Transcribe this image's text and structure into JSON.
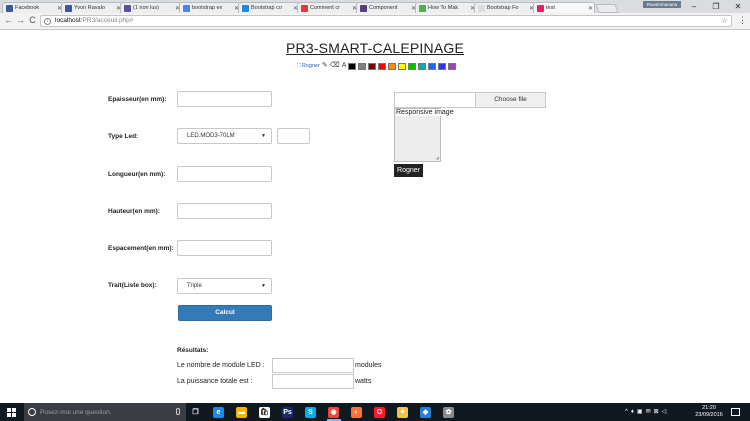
{
  "browser": {
    "tabs": [
      {
        "title": "Facebook",
        "favicon_color": "#3b5998",
        "active": false
      },
      {
        "title": "Yvon Ravalo",
        "favicon_color": "#3b5998",
        "active": false
      },
      {
        "title": "(1 non lus)",
        "favicon_color": "#5b4fa0",
        "active": false
      },
      {
        "title": "bootstrap ex",
        "favicon_color": "#4285f4",
        "active": false
      },
      {
        "title": "Bootstrap co",
        "favicon_color": "#1e88e5",
        "active": false
      },
      {
        "title": "Comment cr",
        "favicon_color": "#e53935",
        "active": false
      },
      {
        "title": "Component",
        "favicon_color": "#563d7c",
        "active": false
      },
      {
        "title": "How To Mak",
        "favicon_color": "#4caf50",
        "active": false
      },
      {
        "title": "Bootstrap Fo",
        "favicon_color": "#dddddd",
        "active": false
      },
      {
        "title": "test",
        "favicon_color": "#e91e63",
        "active": true
      }
    ],
    "close_glyph": "✕",
    "user_badge": "Ravalomanana",
    "window_buttons": {
      "minimize": "–",
      "restore": "❐",
      "close": "✕"
    },
    "url_host": "localhost",
    "url_path": "/PR3/acceuil.php#",
    "nav": {
      "back": "←",
      "forward": "→",
      "reload": "C",
      "menu": "⋮",
      "star": "☆",
      "info": "i"
    }
  },
  "page": {
    "title": "PR3-SMART-CALEPINAGE",
    "toolbar": {
      "crop_label": "Rogner",
      "glyphs": [
        "✎",
        "⌫",
        "A"
      ],
      "swatches": [
        "#000000",
        "#808080",
        "#7f0000",
        "#ff0000",
        "#ff8c00",
        "#ffff00",
        "#00c000",
        "#00b0b0",
        "#1e64ff",
        "#3333ff",
        "#a040c0"
      ]
    },
    "form": {
      "epaisseur_label": "Epaisseur(en mm):",
      "type_led_label": "Type Led:",
      "type_led_value": "LED.MOD3-70LM",
      "longueur_label": "Longueur(en mm):",
      "hauteur_label": "Hauteur(en mm):",
      "espacement_label": "Espacement(en mm):",
      "trait_label": "Trait(Liste box):",
      "trait_value": "Triple",
      "caret": "▼",
      "calcul_button": "Calcul"
    },
    "image_panel": {
      "file_button": "Choose file",
      "preview_alt": "Responsive image",
      "crop_button": "Rogner"
    },
    "results": {
      "title": "Résultats:",
      "modules_label": "Le nombre de module LED :",
      "modules_unit": "modules",
      "power_label": "La puissance totale est :",
      "power_unit": "watts"
    }
  },
  "taskbar": {
    "search_placeholder": "Posez-moi une question.",
    "apps": [
      {
        "name": "task-view",
        "color": "#101820",
        "glyph": "❐"
      },
      {
        "name": "edge",
        "color": "#1e88e5",
        "glyph": "e"
      },
      {
        "name": "explorer",
        "color": "#f4b400",
        "glyph": "▬"
      },
      {
        "name": "store",
        "color": "#ffffff",
        "glyph": "🛍"
      },
      {
        "name": "photoshop",
        "color": "#1b2a6b",
        "glyph": "Ps"
      },
      {
        "name": "skype",
        "color": "#00aff0",
        "glyph": "S"
      },
      {
        "name": "chrome",
        "color": "#e8453c",
        "glyph": "◉"
      },
      {
        "name": "firefox",
        "color": "#ff7139",
        "glyph": "◐"
      },
      {
        "name": "opera",
        "color": "#ff1b2d",
        "glyph": "O"
      },
      {
        "name": "wamp",
        "color": "#f6c343",
        "glyph": "✦"
      },
      {
        "name": "3d-app",
        "color": "#2a7fd4",
        "glyph": "◆"
      },
      {
        "name": "tool-app",
        "color": "#8a8a8a",
        "glyph": "✿"
      }
    ],
    "time": "21:20",
    "date": "23/09/2016",
    "tray_glyphs": [
      "^",
      "♦",
      "▣",
      "✉",
      "⊠",
      "◁"
    ]
  }
}
